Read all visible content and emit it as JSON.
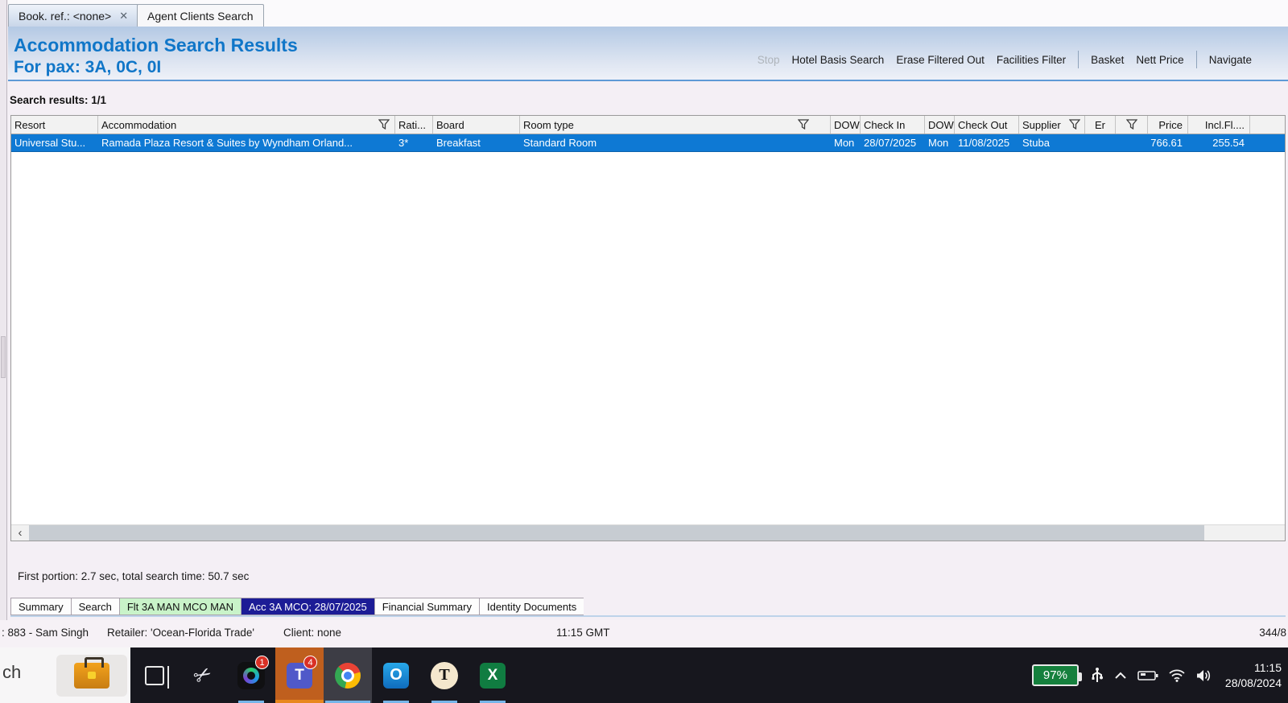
{
  "icons": {
    "close": "✕",
    "scroll_left": "‹",
    "teams_glyph": "T",
    "outlook_glyph": "O",
    "tramada_glyph": "T",
    "excel_glyph": "X",
    "snip_glyph": "✂"
  },
  "window_tabs": {
    "booking": "Book. ref.: <none>",
    "agent": "Agent Clients Search"
  },
  "header": {
    "title": "Accommodation Search Results",
    "subtitle": "For pax: 3A, 0C, 0I"
  },
  "toolbar": {
    "stop": "Stop",
    "hotel_basis": "Hotel Basis Search",
    "erase": "Erase Filtered Out",
    "facilities": "Facilities Filter",
    "basket": "Basket",
    "nett": "Nett Price",
    "navigate": "Navigate"
  },
  "results": {
    "count_label": "Search results: 1/1",
    "timing": "First portion: 2.7 sec, total search time: 50.7 sec"
  },
  "table": {
    "headers": {
      "resort": "Resort",
      "accommodation": "Accommodation",
      "rating": "Rati...",
      "board": "Board",
      "room_type": "Room type",
      "dow_in": "DOW",
      "check_in": "Check In",
      "dow_out": "DOW",
      "check_out": "Check Out",
      "supplier": "Supplier",
      "er": "Er",
      "price": "Price",
      "incl_fl": "Incl.Fl...."
    },
    "row": {
      "resort": "Universal Stu...",
      "accommodation": "Ramada Plaza Resort & Suites by Wyndham Orland...",
      "rating": "3*",
      "board": "Breakfast",
      "room_type": "Standard Room",
      "dow_in": "Mon",
      "check_in": "28/07/2025",
      "dow_out": "Mon",
      "check_out": "11/08/2025",
      "supplier": "Stuba",
      "er": "",
      "price": "766.61",
      "incl_fl": "255.54"
    }
  },
  "bottom_tabs": {
    "summary": "Summary",
    "search": "Search",
    "flight": "Flt 3A MAN MCO MAN",
    "accommodation": "Acc 3A MCO; 28/07/2025",
    "financial": "Financial Summary",
    "identity": "Identity Documents"
  },
  "status_bar": {
    "user": ": 883 - Sam Singh",
    "retailer": "Retailer: 'Ocean-Florida Trade'",
    "client": "Client: none",
    "time": "11:15 GMT",
    "counter": "344/8"
  },
  "taskbar": {
    "search_text": "ch",
    "webex_badge": "1",
    "teams_badge": "4",
    "battery": "97%",
    "time": "11:15",
    "date": "28/08/2024"
  },
  "colors": {
    "accent_blue": "#1076c8",
    "selected_row": "#0e79d4",
    "tab_green": "#c9f3c9",
    "tab_navy": "#1c1c96",
    "battery_green": "#15803d"
  }
}
